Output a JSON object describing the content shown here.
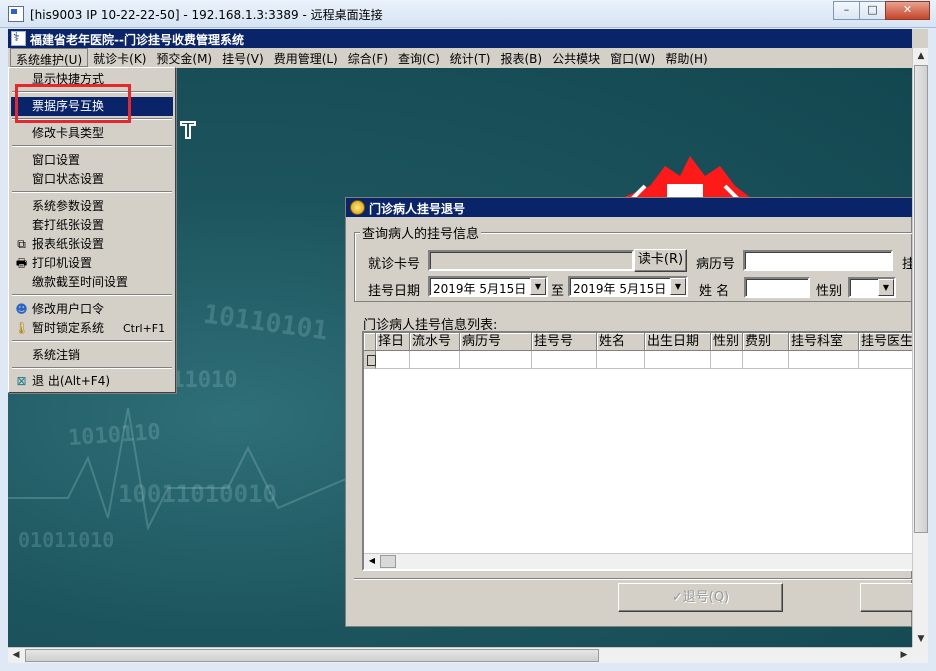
{
  "rdp": {
    "title": "[his9003  IP 10-22-22-50] - 192.168.1.3:3389 - 远程桌面连接",
    "btn_minimize": "–",
    "btn_restore": "□",
    "btn_close": "✕"
  },
  "app": {
    "title": "福建省老年医院--门诊挂号收费管理系统"
  },
  "menubar": [
    "系统维护(U)",
    "就诊卡(K)",
    "预交金(M)",
    "挂号(V)",
    "费用管理(L)",
    "综合(F)",
    "查询(C)",
    "统计(T)",
    "报表(B)",
    "公共模块",
    "窗口(W)",
    "帮助(H)"
  ],
  "system_menu": {
    "items": [
      {
        "label": "显示快捷方式"
      },
      {
        "label": "票据序号互换",
        "selected": true
      },
      {
        "label": "修改卡具类型"
      },
      {
        "label": "窗口设置"
      },
      {
        "label": "窗口状态设置"
      },
      {
        "label": "系统参数设置"
      },
      {
        "label": "套打纸张设置"
      },
      {
        "label": "报表纸张设置",
        "icon": "copy-icon"
      },
      {
        "label": "打印机设置",
        "icon": "printer-icon"
      },
      {
        "label": "缴款截至时间设置"
      },
      {
        "label": "修改用户口令",
        "icon": "users-icon"
      },
      {
        "label": "暂时锁定系统",
        "icon": "thermometer-icon",
        "shortcut": "Ctrl+F1"
      },
      {
        "label": "系统注销"
      },
      {
        "label": "退 出(Alt+F4)",
        "icon": "exit-icon"
      }
    ]
  },
  "background_text": {
    "b1": "10110101",
    "b2": "011010",
    "b3": "1010110",
    "b4": "10011010010",
    "b5": "01011010"
  },
  "dialog": {
    "title": "门诊病人挂号退号",
    "group_title": "查询病人的挂号信息",
    "card_no_label": "就诊卡号",
    "card_no_value": "",
    "read_card_btn": "读卡(R)",
    "record_no_label": "病历号",
    "record_no_value": "",
    "cut_label": "挂",
    "reg_date_label": "挂号日期",
    "date_from": "2019年  5月15日",
    "to_label": "至",
    "date_to": "2019年  5月15日",
    "name_label": "姓  名",
    "name_value": "",
    "gender_label": "性别",
    "gender_value": "",
    "list_title": "门诊病人挂号信息列表:",
    "columns": [
      "择日",
      "流水号",
      "病历号",
      "挂号号",
      "姓名",
      "出生日期",
      "性别",
      "费别",
      "挂号科室",
      "挂号医生"
    ],
    "refund_btn": "✓退号(Q)"
  }
}
